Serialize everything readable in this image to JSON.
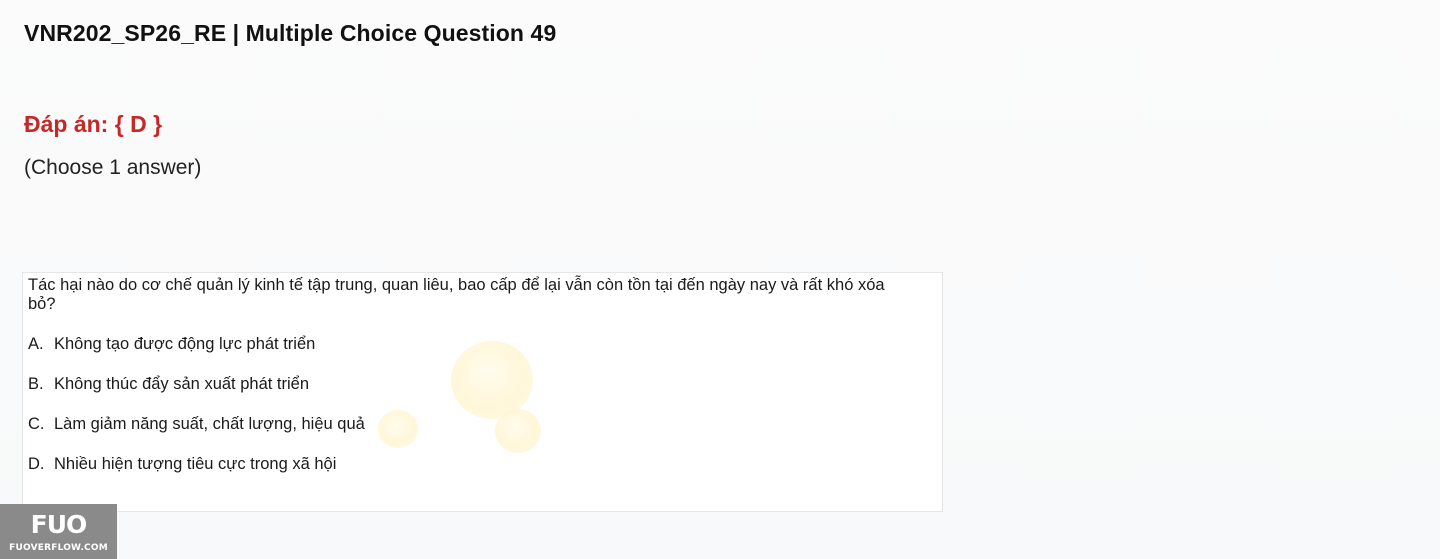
{
  "header": {
    "title": "VNR202_SP26_RE | Multiple Choice Question 49"
  },
  "answer": {
    "text": "Đáp án: { D }"
  },
  "instruction": "(Choose 1 answer)",
  "question": {
    "text": "Tác hại nào do cơ chế quản lý kinh tế tập trung, quan liêu, bao cấp để lại vẫn còn tồn tại đến ngày nay và rất khó xóa bỏ?",
    "options": [
      {
        "letter": "A.",
        "text": "Không tạo được động lực phát triển"
      },
      {
        "letter": "B.",
        "text": "Không thúc đẩy sản xuất phát triển"
      },
      {
        "letter": "C.",
        "text": "Làm giảm năng suất, chất lượng, hiệu quả"
      },
      {
        "letter": "D.",
        "text": "Nhiều hiện tượng tiêu cực trong xã hội"
      }
    ]
  },
  "watermark": {
    "logo": "FUO",
    "site": "FUOVERFLOW.COM"
  }
}
